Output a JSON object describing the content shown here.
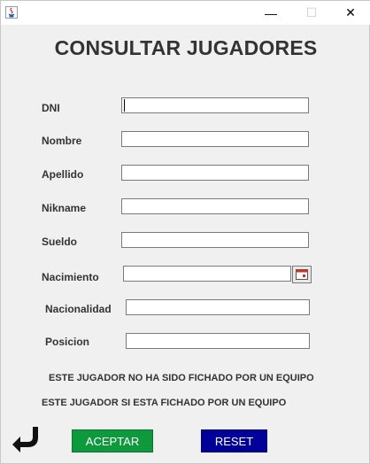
{
  "window": {
    "minimize_glyph": "—",
    "maximize_glyph": "☐",
    "close_glyph": "✕"
  },
  "title": "CONSULTAR JUGADORES",
  "fields": {
    "dni": {
      "label": "DNI",
      "value": ""
    },
    "nombre": {
      "label": "Nombre",
      "value": ""
    },
    "apellido": {
      "label": "Apellido",
      "value": ""
    },
    "nikname": {
      "label": "Nikname",
      "value": ""
    },
    "sueldo": {
      "label": "Sueldo",
      "value": ""
    },
    "nacimiento": {
      "label": "Nacimiento",
      "value": ""
    },
    "nacionalidad": {
      "label": "Nacionalidad",
      "value": ""
    },
    "posicion": {
      "label": "Posicion",
      "value": ""
    }
  },
  "notes": {
    "no_fichado": "ESTE JUGADOR NO HA SIDO FICHADO POR UN EQUIPO",
    "si_fichado": "ESTE JUGADOR SI ESTA FICHADO POR UN EQUIPO"
  },
  "buttons": {
    "aceptar": "ACEPTAR",
    "reset": "RESET"
  },
  "colors": {
    "aceptar_bg": "#0e9a3c",
    "reset_bg": "#000099",
    "text": "#333333"
  },
  "icons": {
    "app": "java-icon",
    "calendar": "calendar-icon",
    "back": "back-arrow-icon"
  }
}
